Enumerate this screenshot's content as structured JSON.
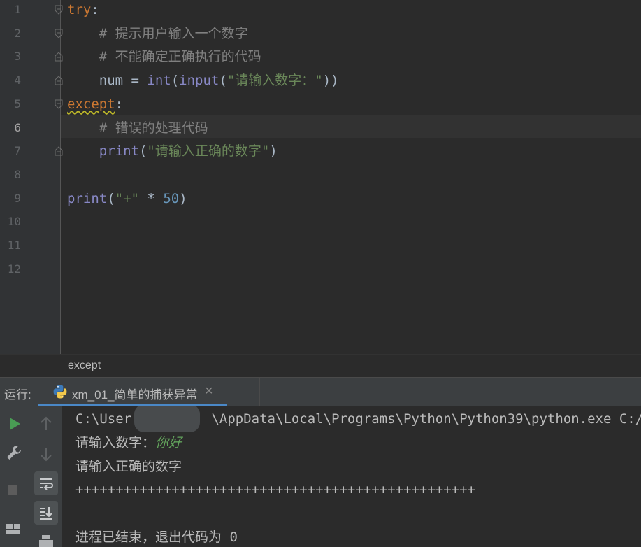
{
  "editor": {
    "line_numbers": [
      "1",
      "2",
      "3",
      "4",
      "5",
      "6",
      "7",
      "8",
      "9",
      "10",
      "11",
      "12"
    ],
    "current_line": "6",
    "lines": [
      {
        "parts": [
          {
            "t": "try",
            "c": "kw"
          },
          {
            "t": ":",
            "c": "op"
          }
        ]
      },
      {
        "parts": [
          {
            "t": "    # 提示用户输入一个数字",
            "c": "cmt"
          }
        ]
      },
      {
        "parts": [
          {
            "t": "    # 不能确定正确执行的代码",
            "c": "cmt"
          }
        ]
      },
      {
        "parts": [
          {
            "t": "    num = ",
            "c": "op"
          },
          {
            "t": "int",
            "c": "fn"
          },
          {
            "t": "(",
            "c": "op"
          },
          {
            "t": "input",
            "c": "fn"
          },
          {
            "t": "(",
            "c": "op"
          },
          {
            "t": "\"请输入数字：\"",
            "c": "str"
          },
          {
            "t": "))",
            "c": "op"
          }
        ]
      },
      {
        "parts": [
          {
            "t": "except",
            "c": "kw squig"
          },
          {
            "t": ":",
            "c": "op"
          }
        ]
      },
      {
        "parts": [
          {
            "t": "    # 错误的处理代码",
            "c": "cmt"
          }
        ]
      },
      {
        "parts": [
          {
            "t": "    ",
            "c": "op"
          },
          {
            "t": "print",
            "c": "fn"
          },
          {
            "t": "(",
            "c": "op"
          },
          {
            "t": "\"请输入正确的数字\"",
            "c": "str"
          },
          {
            "t": ")",
            "c": "op"
          }
        ]
      },
      {
        "parts": []
      },
      {
        "parts": [
          {
            "t": "print",
            "c": "fn"
          },
          {
            "t": "(",
            "c": "op"
          },
          {
            "t": "\"+\"",
            "c": "str"
          },
          {
            "t": " * ",
            "c": "op"
          },
          {
            "t": "50",
            "c": "num"
          },
          {
            "t": ")",
            "c": "op"
          }
        ]
      },
      {
        "parts": []
      },
      {
        "parts": []
      },
      {
        "parts": []
      }
    ]
  },
  "breadcrumb": "except",
  "run_panel": {
    "label": "运行:",
    "tab_title": "xm_01_简单的捕获异常",
    "tab_close": "×"
  },
  "console": {
    "lines": [
      {
        "text": "C:\\User          \\AppData\\Local\\Programs\\Python\\Python39\\python.exe C:/",
        "kind": "out"
      },
      {
        "prompt": "请输入数字：",
        "input": "你好",
        "kind": "prompt"
      },
      {
        "text": "请输入正确的数字",
        "kind": "out"
      },
      {
        "text": "++++++++++++++++++++++++++++++++++++++++++++++++++",
        "kind": "out"
      },
      {
        "text": "",
        "kind": "out"
      },
      {
        "text": "进程已结束，退出代码为 0",
        "kind": "out"
      }
    ]
  },
  "colors": {
    "keyword": "#cc7832",
    "comment": "#808080",
    "string": "#6a8759",
    "builtin": "#8888c6",
    "number": "#6897bb",
    "run_green": "#499c54",
    "tab_underline": "#4a88c7"
  },
  "icons": {
    "run": "run-icon",
    "wrench": "wrench-icon",
    "stop": "stop-icon",
    "layout": "layout-icon",
    "up": "arrow-up-icon",
    "down": "arrow-down-icon",
    "soft_wrap": "soft-wrap-icon",
    "scroll_end": "scroll-to-end-icon",
    "print": "print-icon",
    "python": "python-icon"
  }
}
